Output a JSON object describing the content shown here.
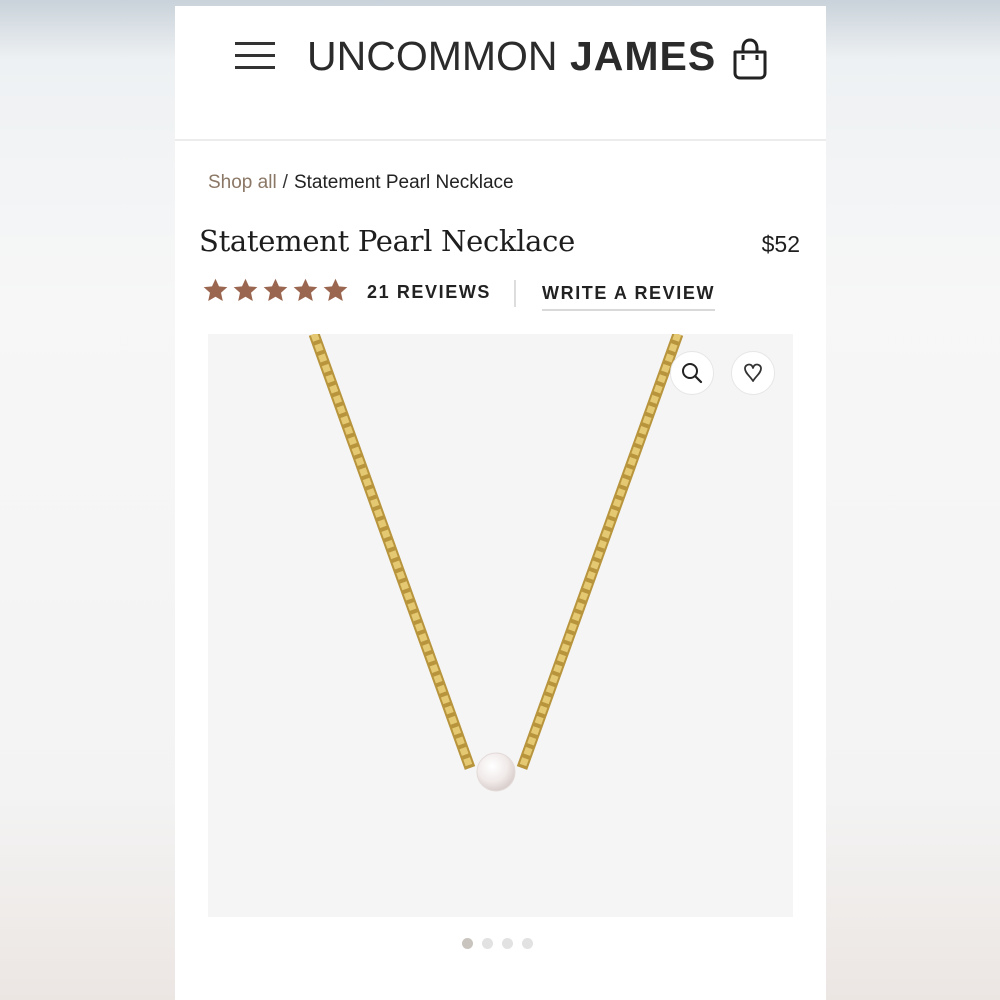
{
  "header": {
    "menu_icon": "hamburger-menu-icon",
    "logo_light": "UNCOMMON",
    "logo_bold": "JAMES",
    "bag_icon": "shopping-bag-icon"
  },
  "breadcrumb": {
    "shop_all": "Shop all",
    "separator": "/",
    "current": "Statement Pearl Necklace"
  },
  "product": {
    "title": "Statement Pearl Necklace",
    "price": "$52",
    "rating": 5,
    "rating_max": 5,
    "reviews_label": "21 REVIEWS",
    "write_review_label": "WRITE A REVIEW",
    "image_icons": [
      "search-icon",
      "heart-icon"
    ],
    "image_pager": {
      "count": 4,
      "active": 0
    }
  },
  "colors": {
    "star": "#9b6650",
    "breadcrumb_link": "#8b7765",
    "chain_gold": "#d8b95a",
    "pearl": "#f4efee"
  }
}
